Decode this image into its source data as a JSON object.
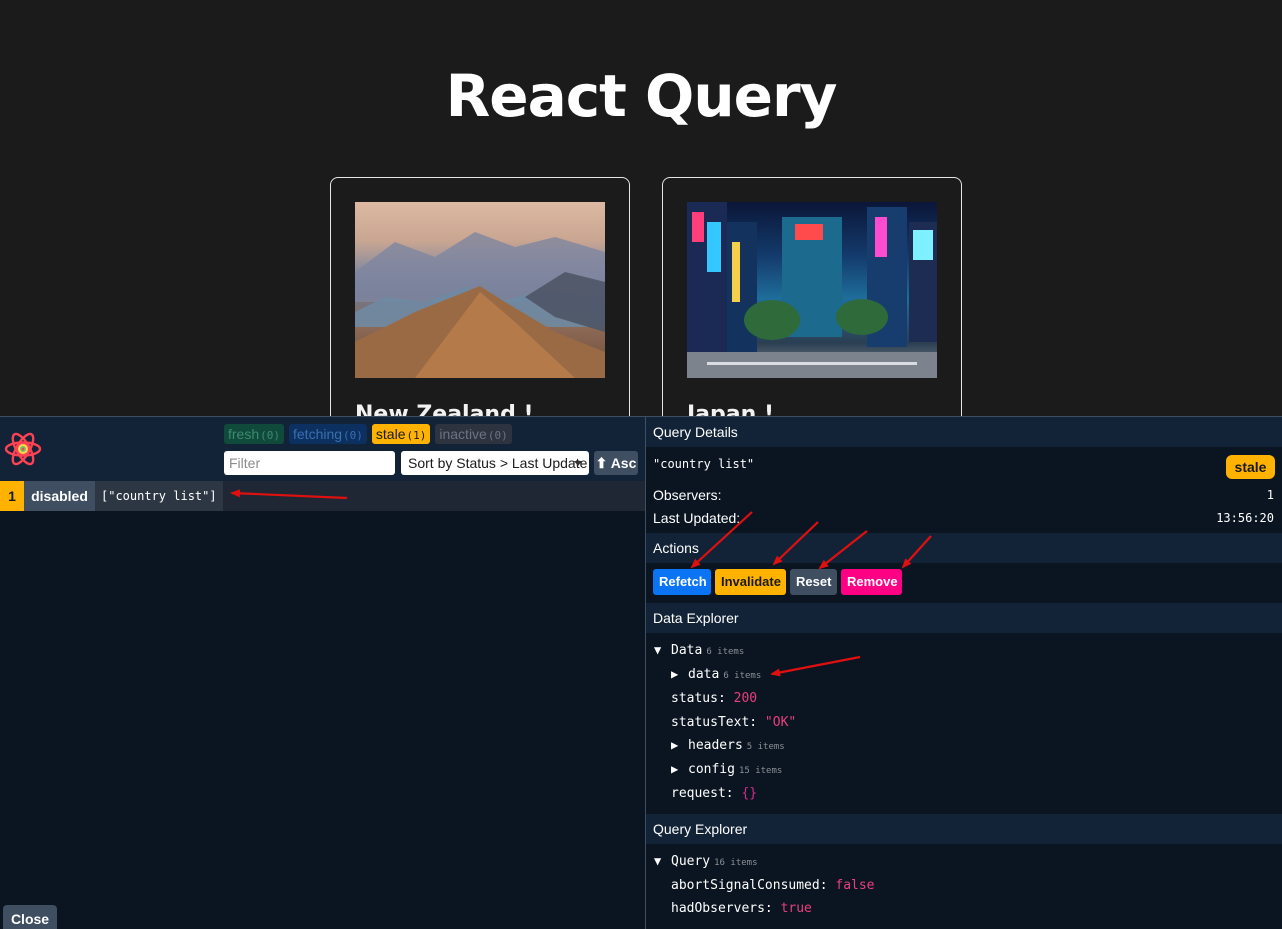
{
  "page": {
    "title": "React Query"
  },
  "cards": [
    {
      "title": "New Zealand !"
    },
    {
      "title": "Japan !"
    }
  ],
  "devtools": {
    "counts": {
      "fresh": {
        "label": "fresh",
        "count": "(0)"
      },
      "fetching": {
        "label": "fetching",
        "count": "(0)"
      },
      "stale": {
        "label": "stale",
        "count": "(1)"
      },
      "inactive": {
        "label": "inactive",
        "count": "(0)"
      }
    },
    "filter": {
      "placeholder": "Filter",
      "value": ""
    },
    "sort": {
      "selected": "Sort by Status > Last Update"
    },
    "asc_label": "⬆ Asc",
    "query_row": {
      "observers": "1",
      "status": "disabled",
      "key": "[\"country list\"]"
    },
    "close_label": "Close",
    "details": {
      "section_title": "Query Details",
      "query_key": "\"country list\"",
      "status_badge": "stale",
      "observers_label": "Observers:",
      "observers_value": "1",
      "last_updated_label": "Last Updated:",
      "last_updated_value": "13:56:20"
    },
    "actions": {
      "section_title": "Actions",
      "refetch": "Refetch",
      "invalidate": "Invalidate",
      "reset": "Reset",
      "remove": "Remove"
    },
    "data_explorer": {
      "section_title": "Data Explorer",
      "root_label": "Data",
      "root_count": "6 items",
      "data_label": "data",
      "data_count": "6 items",
      "status_key": "status:",
      "status_value": "200",
      "status_text_key": "statusText:",
      "status_text_value": "\"OK\"",
      "headers_label": "headers",
      "headers_count": "5 items",
      "config_label": "config",
      "config_count": "15 items",
      "request_key": "request:",
      "request_value": "{}"
    },
    "query_explorer": {
      "section_title": "Query Explorer",
      "root_label": "Query",
      "root_count": "16 items",
      "abort_key": "abortSignalConsumed:",
      "abort_value": "false",
      "had_observers_key": "hadObservers:",
      "had_observers_value": "true"
    }
  },
  "colors": {
    "page_bg": "#1c1b1c",
    "panel_bg": "#0b1521",
    "header_bg": "#132337",
    "stale": "#ffb200",
    "refetch": "#0b74f5",
    "remove": "#ff0085",
    "annotation_arrow": "#e01010"
  }
}
